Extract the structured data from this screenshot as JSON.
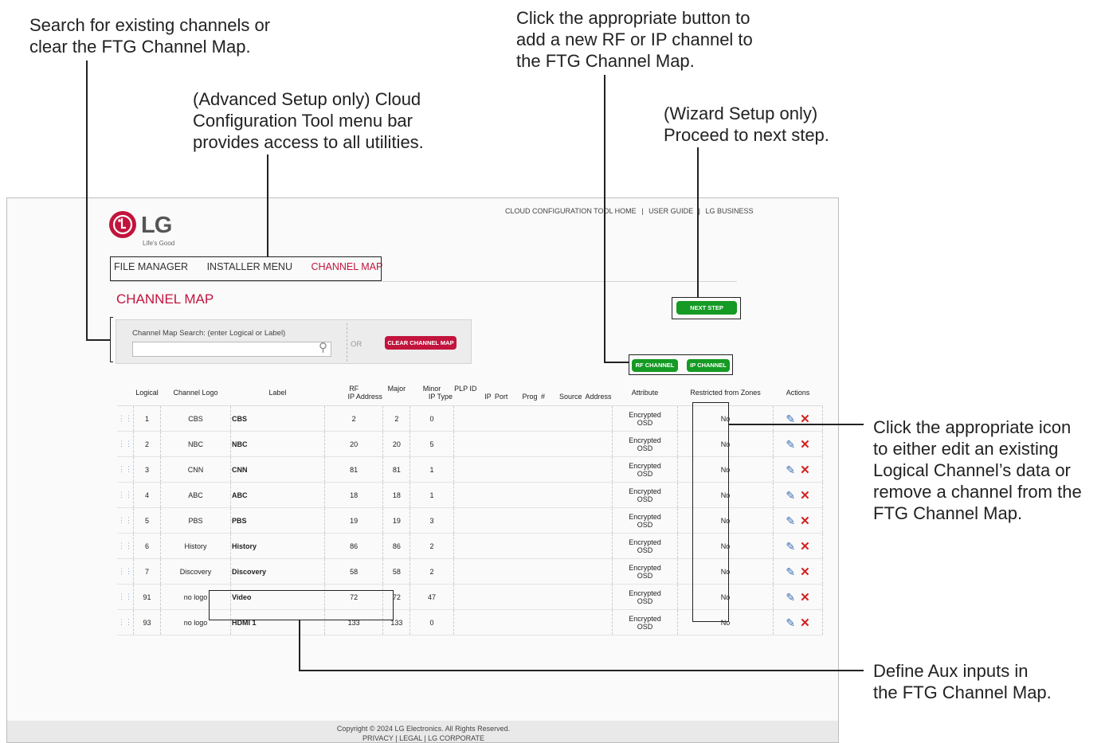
{
  "callouts": {
    "search": [
      "Search for existing channels or",
      "clear the FTG Channel Map."
    ],
    "menu": [
      "(Advanced Setup only) Cloud",
      "Configuration Tool menu bar",
      "provides access to all utilities."
    ],
    "add": [
      "Click the appropriate button to",
      "add a new RF or IP channel to",
      "the FTG Channel Map."
    ],
    "next": [
      "(Wizard Setup only)",
      "Proceed to next step."
    ],
    "actions": [
      "Click the appropriate icon",
      "to either edit an existing",
      "Logical Channel’s data or",
      "remove a channel from the",
      "FTG Channel Map."
    ],
    "aux": [
      "Define Aux inputs in",
      "the FTG Channel Map."
    ]
  },
  "toplinks": [
    "CLOUD CONFIGURATION TOOL HOME",
    "|",
    "USER GUIDE",
    "|",
    "LG BUSINESS"
  ],
  "logo": {
    "text": "LG",
    "tagline": "Life's Good"
  },
  "menu": {
    "file_manager": "FILE MANAGER",
    "installer_menu": "INSTALLER MENU",
    "channel_map": "CHANNEL MAP"
  },
  "page_title": "CHANNEL MAP",
  "search": {
    "label": "Channel Map Search: (enter Logical or Label)",
    "value": "",
    "or": "OR",
    "clear_button": "CLEAR CHANNEL MAP"
  },
  "buttons": {
    "next_step": "NEXT STEP",
    "rf_channel": "RF CHANNEL",
    "ip_channel": "IP CHANNEL"
  },
  "columns": {
    "logical": "Logical",
    "logo": "Channel Logo",
    "label": "Label",
    "rf": "RF",
    "major": "Major",
    "minor": "Minor",
    "plp": "PLP ID",
    "ip_address": "IP Address",
    "ip_type": "IP Type",
    "ip_port": "IP Port",
    "prog": "Prog #",
    "source": "Source Address",
    "attribute": "Attribute",
    "restricted": "Restricted from Zones",
    "actions": "Actions"
  },
  "rows": [
    {
      "logical": "1",
      "logo": "CBS",
      "label": "CBS",
      "rf": "2",
      "major": "2",
      "minor": "0",
      "attr1": "Encrypted",
      "attr2": "OSD",
      "restricted": "No"
    },
    {
      "logical": "2",
      "logo": "NBC",
      "label": "NBC",
      "rf": "20",
      "major": "20",
      "minor": "5",
      "attr1": "Encrypted",
      "attr2": "OSD",
      "restricted": "No"
    },
    {
      "logical": "3",
      "logo": "CNN",
      "label": "CNN",
      "rf": "81",
      "major": "81",
      "minor": "1",
      "attr1": "Encrypted",
      "attr2": "OSD",
      "restricted": "No"
    },
    {
      "logical": "4",
      "logo": "ABC",
      "label": "ABC",
      "rf": "18",
      "major": "18",
      "minor": "1",
      "attr1": "Encrypted",
      "attr2": "OSD",
      "restricted": "No"
    },
    {
      "logical": "5",
      "logo": "PBS",
      "label": "PBS",
      "rf": "19",
      "major": "19",
      "minor": "3",
      "attr1": "Encrypted",
      "attr2": "OSD",
      "restricted": "No"
    },
    {
      "logical": "6",
      "logo": "History",
      "label": "History",
      "rf": "86",
      "major": "86",
      "minor": "2",
      "attr1": "Encrypted",
      "attr2": "OSD",
      "restricted": "No"
    },
    {
      "logical": "7",
      "logo": "Discovery",
      "label": "Discovery",
      "rf": "58",
      "major": "58",
      "minor": "2",
      "attr1": "Encrypted",
      "attr2": "OSD",
      "restricted": "No"
    },
    {
      "logical": "91",
      "logo": "no logo",
      "label": "Video",
      "rf": "72",
      "major": "72",
      "minor": "47",
      "attr1": "Encrypted",
      "attr2": "OSD",
      "restricted": "No"
    },
    {
      "logical": "93",
      "logo": "no logo",
      "label": "HDMI 1",
      "rf": "133",
      "major": "133",
      "minor": "0",
      "attr1": "Encrypted",
      "attr2": "OSD",
      "restricted": "No"
    }
  ],
  "footer": {
    "copyright": "Copyright © 2024 LG Electronics. All Rights Reserved.",
    "links": [
      "PRIVACY",
      "|",
      "LEGAL",
      "|",
      "LG CORPORATE"
    ]
  },
  "icons": {
    "drag": "drag-handle-icon",
    "edit": "edit-pencil-icon",
    "delete": "delete-x-icon",
    "search": "search-icon"
  },
  "colors": {
    "brand_red": "#c2143d",
    "button_green": "#159a24"
  }
}
